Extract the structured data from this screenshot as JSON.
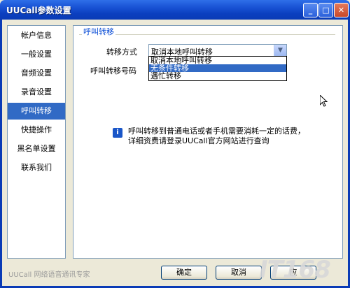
{
  "window": {
    "title": "UUCall参数设置",
    "min_icon": "minimize-icon",
    "max_icon": "maximize-icon",
    "close_icon": "close-icon"
  },
  "sidebar": {
    "items": [
      {
        "label": "帐户信息",
        "selected": false
      },
      {
        "label": "一般设置",
        "selected": false
      },
      {
        "label": "音频设置",
        "selected": false
      },
      {
        "label": "录音设置",
        "selected": false
      },
      {
        "label": "呼叫转移",
        "selected": true
      },
      {
        "label": "快捷操作",
        "selected": false
      },
      {
        "label": "黑名单设置",
        "selected": false
      },
      {
        "label": "联系我们",
        "selected": false
      }
    ]
  },
  "content": {
    "section_title": "呼叫转移",
    "transfer_mode_label": "转移方式",
    "transfer_number_label": "呼叫转移号码",
    "transfer_mode_value": "取消本地呼叫转移",
    "dropdown_options": [
      {
        "label": "取消本地呼叫转移",
        "highlighted": false
      },
      {
        "label": "无条件转移",
        "highlighted": true
      },
      {
        "label": "遇忙转移",
        "highlighted": false
      }
    ],
    "info_line1": "呼叫转移到普通电话或者手机需要消耗一定的话费，",
    "info_line2": "详细资费请登录UUCall官方网站进行查询"
  },
  "footer": {
    "caption": "UUCall 网络语音通讯专家",
    "ok_label": "确定",
    "cancel_label": "取消",
    "apply_label": "应"
  },
  "watermark": "IT168",
  "colors": {
    "titlebar": "#0a3bb6",
    "selection": "#316ac5",
    "group_title": "#0046d5"
  }
}
